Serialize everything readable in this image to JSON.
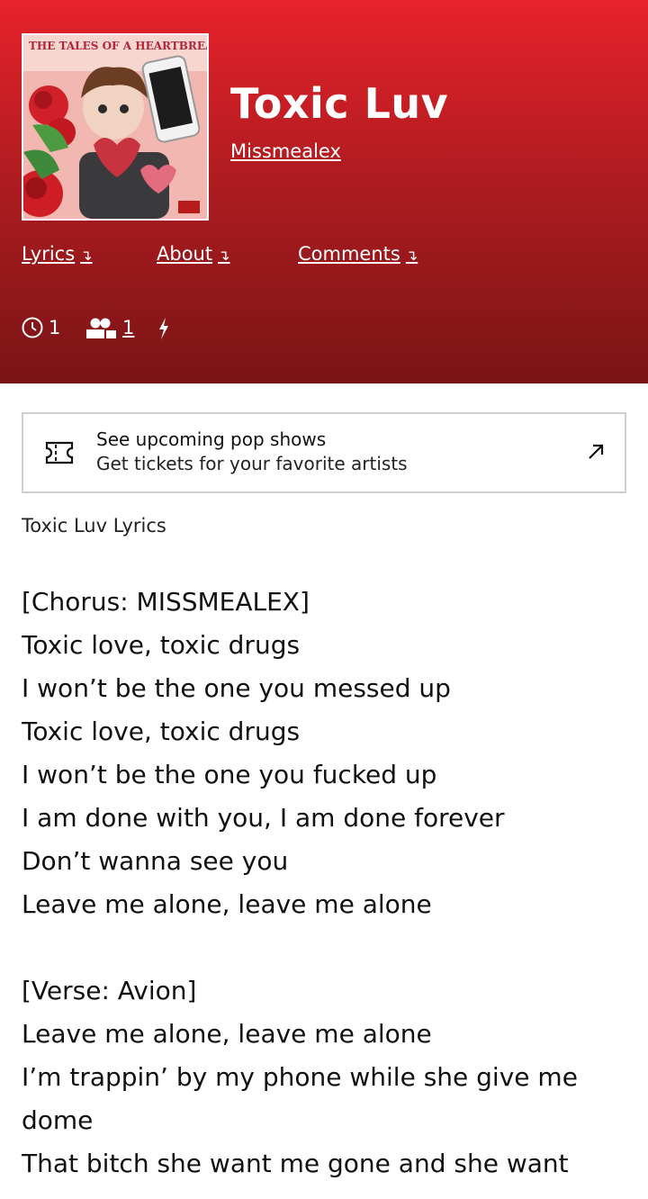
{
  "song": {
    "title": "Toxic Luv",
    "artist": "Missmealex"
  },
  "nav": [
    {
      "label": "Lyrics",
      "arrow": "↴"
    },
    {
      "label": "About",
      "arrow": "↴"
    },
    {
      "label": "Comments",
      "arrow": "↴"
    }
  ],
  "stats": {
    "views_icon": "clock-icon",
    "views": "1",
    "contributors_icon": "people-icon",
    "contributors": "1",
    "hot_icon": "lightning-icon"
  },
  "promo": {
    "icon": "ticket-icon",
    "title": "See upcoming pop shows",
    "subtitle": "Get tickets for your favorite artists",
    "action_icon": "external-arrow-icon"
  },
  "cover_art": {
    "text_top": "THE TALES OF A HEARTBREAK"
  },
  "lyrics_heading": "Toxic Luv Lyrics",
  "lyrics_lines": [
    "[Chorus: MISSMEALEX]",
    "Toxic love, toxic drugs",
    "I won’t be the one you messed up",
    "Toxic love, toxic drugs",
    "I won’t be the one you fucked up",
    "I am done with you, I am done forever",
    "Don’t wanna see you",
    "Leave me alone, leave me alone",
    "",
    "[Verse: Avion]",
    "Leave me alone, leave me alone",
    "I’m trappin’ by my phone while she give me",
    "dome",
    "That bitch she want me gone and she want"
  ],
  "colors": {
    "header_top": "#e8222b",
    "header_bottom": "#7a1416",
    "text_on_header": "#ffffff",
    "promo_border": "#cfcfcf"
  }
}
